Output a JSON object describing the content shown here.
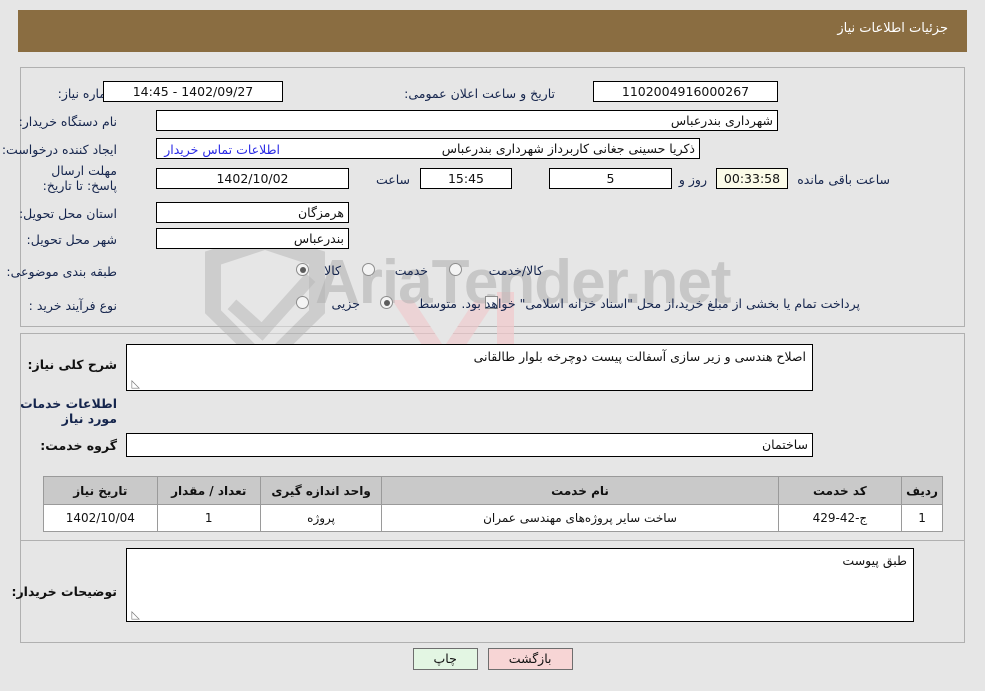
{
  "header": {
    "title": "جزئیات اطلاعات نیاز",
    "bar_color": "#8a6d41"
  },
  "need_info": {
    "need_number_label": "شماره نیاز:",
    "need_number_value": "1102004916000267",
    "announce_label": "تاریخ و ساعت اعلان عمومی:",
    "announce_value": "1402/09/27 - 14:45",
    "buyer_org_label": "نام دستگاه خریدار:",
    "buyer_org_value": "شهرداری بندرعباس",
    "creator_label": "ایجاد کننده درخواست:",
    "creator_value": "ذکریا حسینی جغانی کاربرداز شهرداری بندرعباس",
    "contact_link": "اطلاعات تماس خریدار",
    "deadline_label": "مهلت ارسال پاسخ: تا تاریخ:",
    "deadline_date": "1402/10/02",
    "hour_label": "ساعت",
    "deadline_time": "15:45",
    "days_value": "5",
    "days_text": "روز و",
    "timer_value": "00:33:58",
    "remaining_text": "ساعت باقی مانده",
    "province_label": "استان محل تحویل:",
    "province_value": "هرمزگان",
    "city_label": "شهر محل تحویل:",
    "city_value": "بندرعباس",
    "category_label": "طبقه بندی موضوعی:",
    "category_options": [
      {
        "label": "کالا",
        "selected": false
      },
      {
        "label": "خدمت",
        "selected": true
      },
      {
        "label": "کالا/خدمت",
        "selected": false
      }
    ],
    "process_label": "نوع فرآیند خرید :",
    "process_options": [
      {
        "label": "جزیی",
        "selected": false
      },
      {
        "label": "متوسط",
        "selected": true
      }
    ],
    "treasury_checkbox_text": "پرداخت تمام یا بخشی از مبلغ خرید،از محل \"اسناد خزانه اسلامی\" خواهد بود.",
    "treasury_checked": false
  },
  "description": {
    "label": "شرح کلی نیاز:",
    "value": "اصلاح هندسی و زیر سازی آسفالت پیست دوچرخه بلوار طالقانی"
  },
  "services": {
    "section_title": "اطلاعات خدمات مورد نیاز",
    "group_label": "گروه خدمت:",
    "group_value": "ساختمان",
    "table": {
      "columns": [
        "ردیف",
        "کد خدمت",
        "نام خدمت",
        "واحد اندازه گیری",
        "تعداد / مقدار",
        "تاریخ نیاز"
      ],
      "rows": [
        {
          "radif": "1",
          "code": "ج-42-429",
          "name": "ساخت سایر پروژه‌های مهندسی عمران",
          "unit": "پروژه",
          "qty": "1",
          "date": "1402/10/04"
        }
      ]
    }
  },
  "buyer_notes": {
    "label": "توضیحات خریدار:",
    "value": "طبق پیوست"
  },
  "footer": {
    "back_label": "بازگشت",
    "print_label": "چاپ"
  },
  "watermark": {
    "text": "AriaTender",
    "suffix": ".net"
  }
}
